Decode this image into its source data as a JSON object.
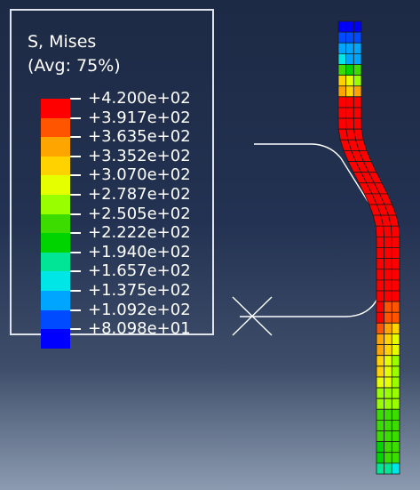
{
  "legend": {
    "title_line1": "S, Mises",
    "title_line2": "(Avg: 75%)",
    "values": [
      "+4.200e+02",
      "+3.917e+02",
      "+3.635e+02",
      "+3.352e+02",
      "+3.070e+02",
      "+2.787e+02",
      "+2.505e+02",
      "+2.222e+02",
      "+1.940e+02",
      "+1.657e+02",
      "+1.375e+02",
      "+1.092e+02",
      "+8.098e+01"
    ],
    "colors": [
      "#ff0000",
      "#ff5500",
      "#ffa500",
      "#ffd200",
      "#e6ff00",
      "#99ff00",
      "#3cdc00",
      "#00d400",
      "#00e696",
      "#00e6e6",
      "#00a5ff",
      "#004bff",
      "#0000ff"
    ]
  },
  "viewport": {
    "background_top": "#1d2a45",
    "background_bottom": "#8c9bb0",
    "mesh_line_color": "#1a1a1a",
    "surface_color": "#ffffff"
  }
}
